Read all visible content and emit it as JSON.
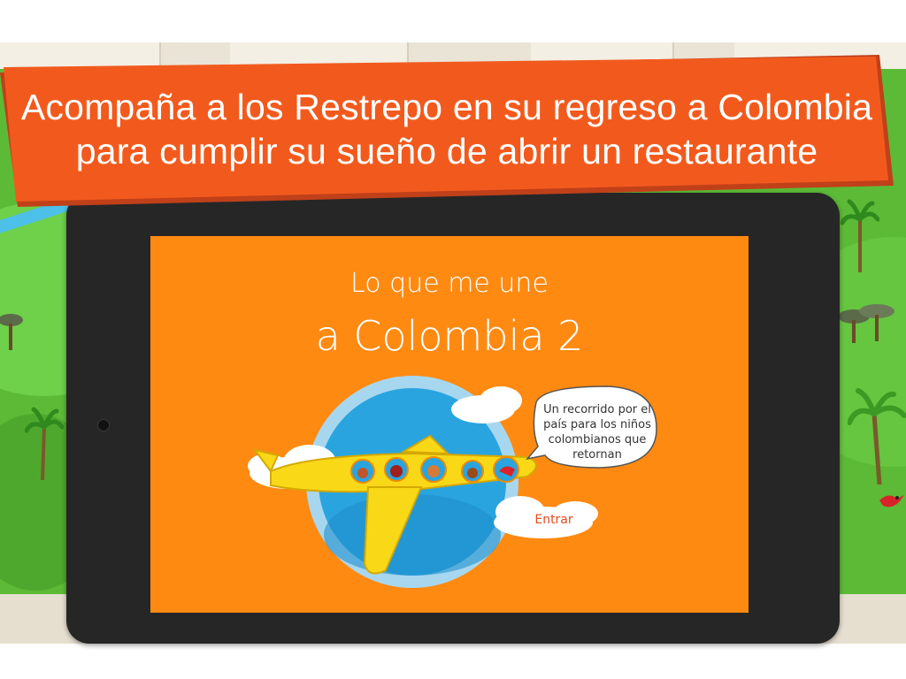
{
  "banner": {
    "line1": "Acompaña a los Restrepo en su regreso a Colombia",
    "line2": "para cumplir su sueño de abrir un restaurante",
    "color": "#f25a1d"
  },
  "screen": {
    "title_line1": "Lo que me une",
    "title_line2": "a Colombia 2",
    "speech_bubble": "Un recorrido por el país para los niños colombianos que retornan",
    "enter_button": "Entrar",
    "background_color": "#ff8a12"
  },
  "icons": {
    "airplane": "airplane-illustration",
    "camera": "camera-icon",
    "trees": "palm-tree-icon",
    "bird": "red-bird-icon"
  }
}
